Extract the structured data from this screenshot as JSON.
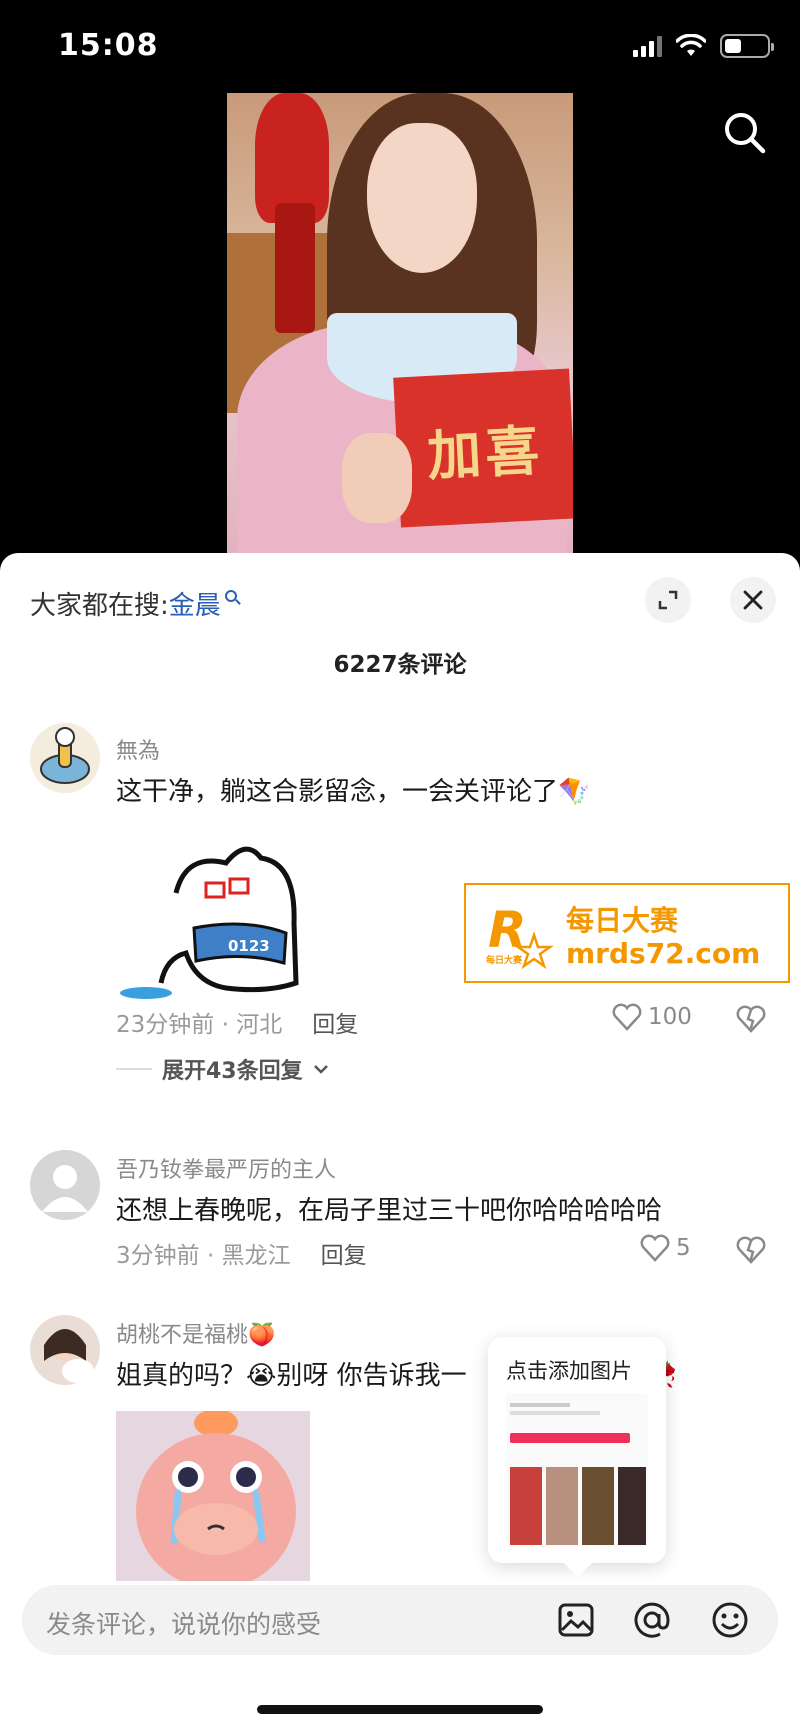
{
  "status_bar": {
    "time": "15:08"
  },
  "hot_search": {
    "prefix": "大家都在搜:",
    "keyword": "金晨"
  },
  "comment_count": "6227条评论",
  "comments": [
    {
      "username": "無為",
      "text": "这干净，躺这合影留念，一会关评论了🪁",
      "time_location": "23分钟前 · 河北",
      "reply_label": "回复",
      "likes": "100",
      "expand_label": "展开43条回复"
    },
    {
      "username": "吾乃钕拳最严厉的主人",
      "text": "还想上春晚呢，在局子里过三十吧你哈哈哈哈哈",
      "time_location": "3分钟前 · 黑龙江",
      "reply_label": "回复",
      "likes": "5"
    },
    {
      "username": "胡桃不是福桃🍑",
      "text": "姐真的吗？😭别呀 你告诉我一",
      "text_tail": "🥀"
    }
  ],
  "sticker_text": "0123",
  "video_text": "加喜",
  "ad": {
    "title": "每日大赛",
    "url": "mrds72.com",
    "logo_letter": "R",
    "logo_caption": "每日大赛"
  },
  "popup": {
    "title": "点击添加图片"
  },
  "input": {
    "placeholder": "发条评论，说说你的感受"
  }
}
